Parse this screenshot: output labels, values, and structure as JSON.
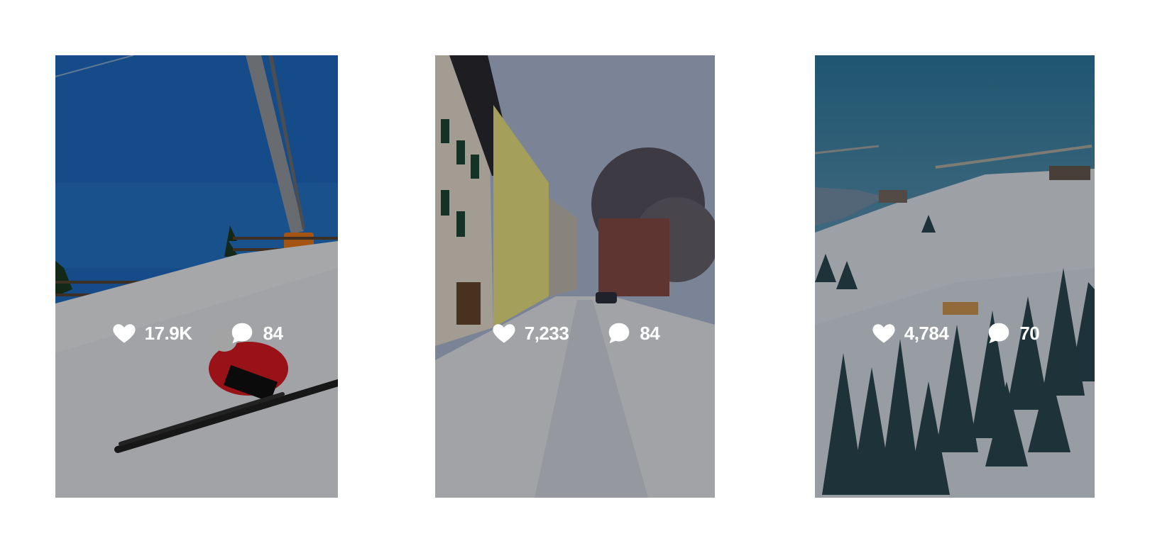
{
  "posts": [
    {
      "likes": "17.9K",
      "comments": "84"
    },
    {
      "likes": "7,233",
      "comments": "84"
    },
    {
      "likes": "4,784",
      "comments": "70"
    }
  ],
  "icons": {
    "like": "heart-icon",
    "comment": "comment-bubble-icon"
  }
}
